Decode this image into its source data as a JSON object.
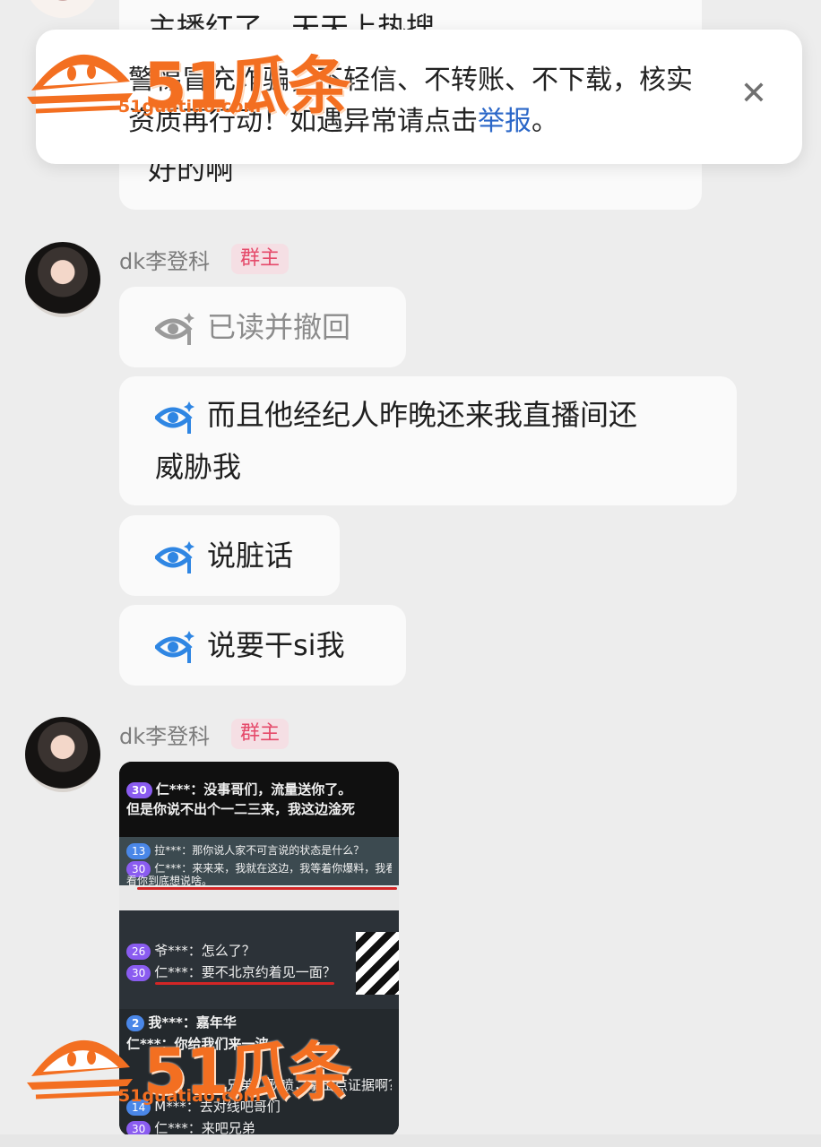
{
  "top_message": {
    "line1": "主播红了，天天上热搜",
    "line2": "好的啊"
  },
  "notice": {
    "text_prefix": "警惕冒充诈骗，不轻信、不转账、不下载，核实资质再行动！如遇异常请点击",
    "link_label": "举报",
    "text_suffix": "。",
    "close_icon": "close-icon"
  },
  "messages": [
    {
      "sender": "dk李登科",
      "badge": "群主",
      "bubbles": [
        {
          "icon": "eye-icon",
          "state": "recalled",
          "text": "已读并撤回"
        },
        {
          "icon": "eye-icon",
          "state": "read",
          "text": "而且他经纪人昨晚还来我直播间还\n威胁我"
        },
        {
          "icon": "eye-icon",
          "state": "read",
          "text": "说脏话"
        },
        {
          "icon": "eye-icon",
          "state": "read",
          "text": "说要干si我"
        }
      ]
    },
    {
      "sender": "dk李登科",
      "badge": "群主",
      "image": {
        "rows": [
          {
            "level": "30",
            "text": "仁***：没事哥们，流量送你了。"
          },
          {
            "level": "",
            "text": "但是你说不出个一二三来，我这边淦死"
          },
          {
            "level": "13",
            "text": "拉***：那你说人家不可言说的状态是什么？"
          },
          {
            "level": "30",
            "text": "仁***：来来来，我就在这边，我等着你爆料，我看"
          },
          {
            "level": "",
            "text": "看你到底想说啥。"
          },
          {
            "level": "26",
            "text": "爷***：怎么了？"
          },
          {
            "level": "30",
            "text": "仁***：要不北京约着见一面？"
          },
          {
            "level": "2",
            "text": "我***：嘉年华"
          },
          {
            "level": "",
            "text": "仁***：你给我们来一波"
          },
          {
            "level": "",
            "text": "兄弟，耿喷，拿出点证据啊？"
          },
          {
            "level": "14",
            "text": "M***：去对线吧哥们"
          },
          {
            "level": "30",
            "text": "仁***：来吧兄弟"
          }
        ]
      }
    }
  ],
  "watermark": {
    "logo_text": "51瓜条",
    "url": "51guatiao.com"
  },
  "colors": {
    "accent_link": "#2b67c8",
    "badge_text": "#e54a6a",
    "watermark": "#f36f21",
    "eye_read": "#2f86e3",
    "eye_recalled": "#9a9a9a"
  }
}
